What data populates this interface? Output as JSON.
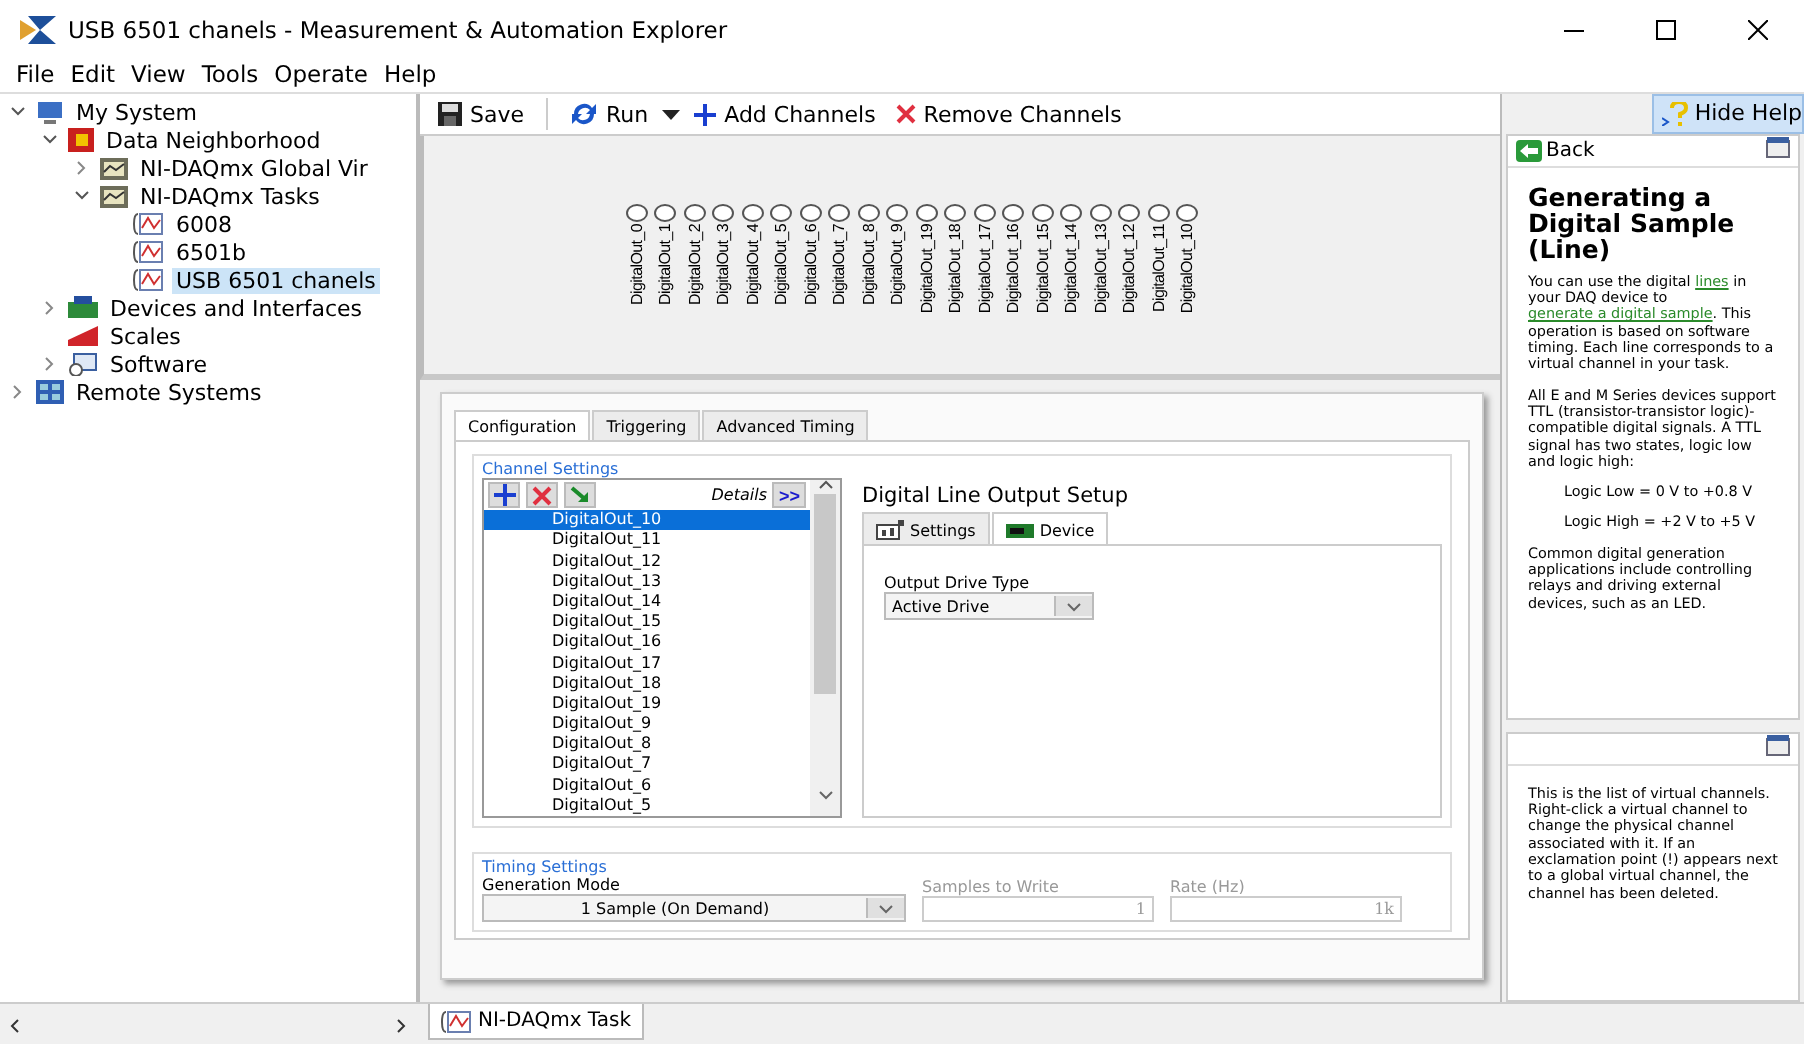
{
  "window": {
    "title": "USB 6501 chanels - Measurement & Automation Explorer"
  },
  "menu": [
    "File",
    "Edit",
    "View",
    "Tools",
    "Operate",
    "Help"
  ],
  "tree": [
    {
      "label": "My System",
      "kind": "system",
      "expanded": true,
      "children": [
        {
          "label": "Data Neighborhood",
          "kind": "neighborhood",
          "expanded": true,
          "children": [
            {
              "label": "NI-DAQmx Global Vir",
              "kind": "daqmx",
              "expanded": false
            },
            {
              "label": "NI-DAQmx Tasks",
              "kind": "daqmx",
              "expanded": true,
              "children": [
                {
                  "label": "6008",
                  "kind": "task",
                  "selected": false
                },
                {
                  "label": "6501b",
                  "kind": "task",
                  "selected": false
                },
                {
                  "label": "USB 6501 chanels",
                  "kind": "task",
                  "selected": true
                }
              ]
            }
          ]
        },
        {
          "label": "Devices and Interfaces",
          "kind": "devices",
          "expanded": false
        },
        {
          "label": "Scales",
          "kind": "scales"
        },
        {
          "label": "Software",
          "kind": "software",
          "expanded": false
        }
      ]
    },
    {
      "label": "Remote Systems",
      "kind": "remote",
      "expanded": false
    }
  ],
  "toolbar": [
    {
      "label": "Save",
      "kind": "save"
    },
    {
      "label": "Run",
      "kind": "run"
    },
    {
      "kind": "caret"
    },
    {
      "label": "Add Channels",
      "kind": "add"
    },
    {
      "label": "Remove Channels",
      "kind": "remove"
    }
  ],
  "hide_help": "Hide Help",
  "leds": [
    "DigitalOut_0",
    "DigitalOut_1",
    "DigitalOut_2",
    "DigitalOut_3",
    "DigitalOut_4",
    "DigitalOut_5",
    "DigitalOut_6",
    "DigitalOut_7",
    "DigitalOut_8",
    "DigitalOut_9",
    "DigitalOut_19",
    "DigitalOut_18",
    "DigitalOut_17",
    "DigitalOut_16",
    "DigitalOut_15",
    "DigitalOut_14",
    "DigitalOut_13",
    "DigitalOut_12",
    "DigitalOut_11",
    "DigitalOut_10"
  ],
  "tabs": [
    {
      "label": "Configuration",
      "selected": true
    },
    {
      "label": "Triggering",
      "selected": false
    },
    {
      "label": "Advanced Timing",
      "selected": false
    }
  ],
  "channel_settings": {
    "title": "Channel Settings",
    "details": "Details",
    "details_button": ">>",
    "channels": [
      {
        "name": "DigitalOut_10",
        "selected": true
      },
      {
        "name": "DigitalOut_11",
        "selected": false
      },
      {
        "name": "DigitalOut_12",
        "selected": false
      },
      {
        "name": "DigitalOut_13",
        "selected": false
      },
      {
        "name": "DigitalOut_14",
        "selected": false
      },
      {
        "name": "DigitalOut_15",
        "selected": false
      },
      {
        "name": "DigitalOut_16",
        "selected": false
      },
      {
        "name": "DigitalOut_17",
        "selected": false
      },
      {
        "name": "DigitalOut_18",
        "selected": false
      },
      {
        "name": "DigitalOut_19",
        "selected": false
      },
      {
        "name": "DigitalOut_9",
        "selected": false
      },
      {
        "name": "DigitalOut_8",
        "selected": false
      },
      {
        "name": "DigitalOut_7",
        "selected": false
      },
      {
        "name": "DigitalOut_6",
        "selected": false
      },
      {
        "name": "DigitalOut_5",
        "selected": false
      }
    ]
  },
  "setup": {
    "title": "Digital Line Output Setup",
    "tabs": [
      {
        "label": "Settings",
        "kind": "settings",
        "selected": false
      },
      {
        "label": "Device",
        "kind": "device",
        "selected": true
      }
    ],
    "output_drive_type": {
      "label": "Output Drive Type",
      "value": "Active Drive"
    }
  },
  "timing": {
    "title": "Timing Settings",
    "generation_mode": {
      "label": "Generation Mode",
      "value": "1 Sample (On Demand)"
    },
    "samples_to_write": {
      "label": "Samples to Write",
      "value": "1",
      "disabled": true
    },
    "rate": {
      "label": "Rate (Hz)",
      "value": "1k",
      "disabled": true
    }
  },
  "help": {
    "back": "Back",
    "title": "Generating a Digital Sample (Line)",
    "blocks": [
      {
        "kind": "paragraph",
        "segments": [
          {
            "text": "You can use the digital ",
            "kind": "text"
          },
          {
            "text": "lines",
            "kind": "link"
          },
          {
            "text": " in your DAQ device to ",
            "kind": "text"
          },
          {
            "text": "generate a digital sample",
            "kind": "link"
          },
          {
            "text": ". This operation is based on software timing. Each line corresponds to a virtual channel in your task.",
            "kind": "text"
          }
        ]
      },
      {
        "kind": "paragraph",
        "segments": [
          {
            "text": "All E and M Series devices support TTL (transistor-transistor logic)-compatible digital signals. A TTL signal has two states, logic low and logic high:",
            "kind": "text"
          }
        ]
      },
      {
        "kind": "indented",
        "segments": [
          {
            "text": "Logic Low = 0 V to +0.8 V",
            "kind": "text"
          }
        ]
      },
      {
        "kind": "indented",
        "segments": [
          {
            "text": "Logic High = +2 V to +5 V",
            "kind": "text"
          }
        ]
      },
      {
        "kind": "paragraph",
        "segments": [
          {
            "text": "Common digital generation applications include controlling relays and driving external devices, such as an LED.",
            "kind": "text"
          }
        ]
      }
    ],
    "context": "This is the list of virtual channels. Right-click a virtual channel to change the physical channel associated with it. If an exclamation point (!) appears next to a global virtual channel, the channel has been deleted."
  },
  "bottom_tab": "NI-DAQmx Task"
}
